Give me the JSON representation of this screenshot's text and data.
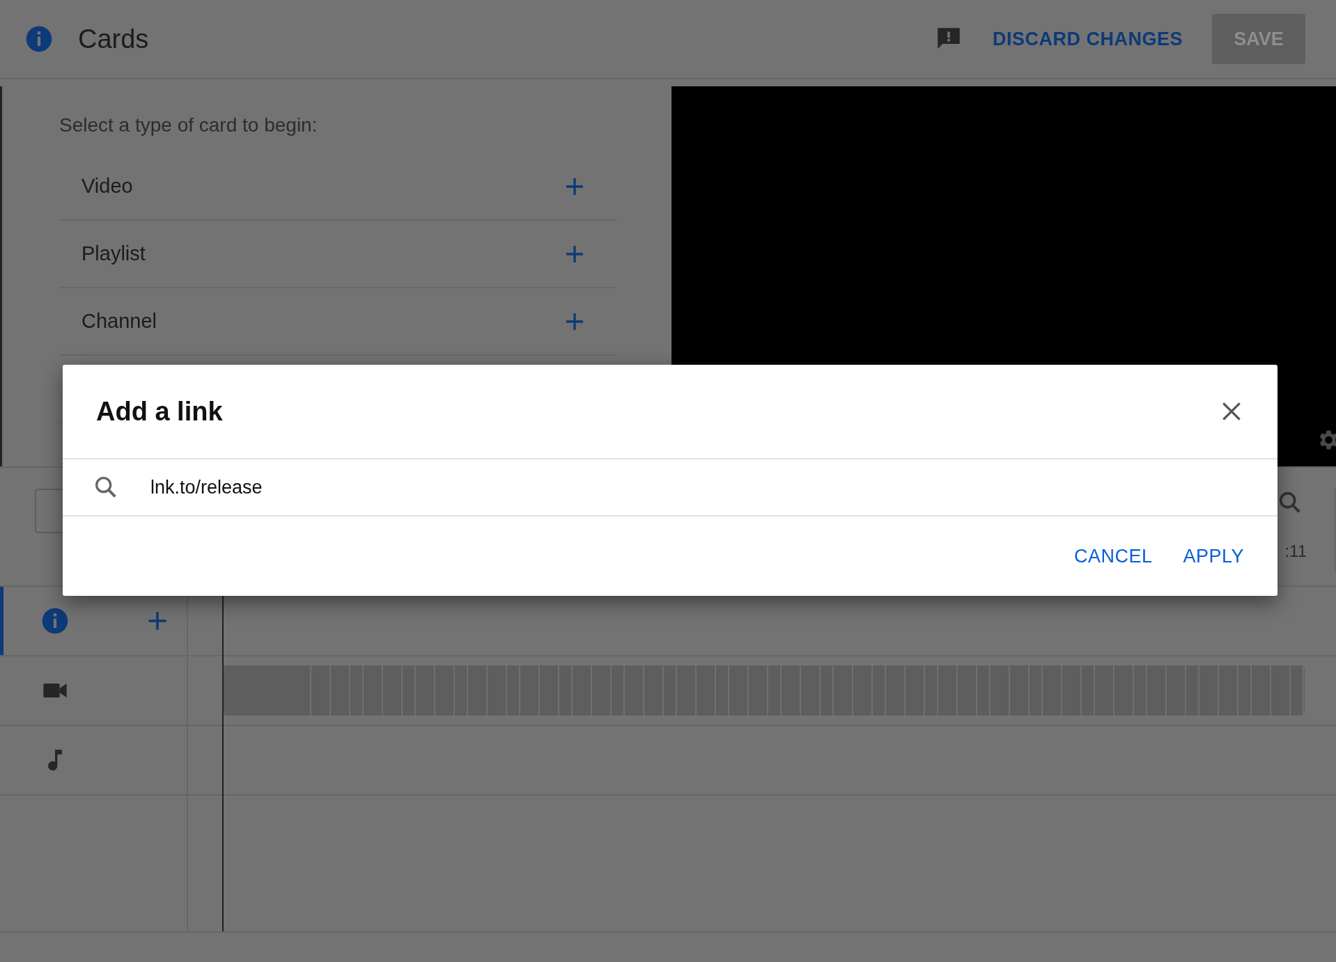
{
  "header": {
    "title": "Cards",
    "discard_label": "DISCARD CHANGES",
    "save_label": "SAVE",
    "save_disabled": true
  },
  "card_types": {
    "prompt": "Select a type of card to begin:",
    "items": [
      {
        "label": "Video"
      },
      {
        "label": "Playlist"
      },
      {
        "label": "Channel"
      }
    ]
  },
  "timeline": {
    "time_label": ":11",
    "tracks": [
      {
        "kind": "info",
        "selected": true
      },
      {
        "kind": "video",
        "selected": false
      },
      {
        "kind": "audio",
        "selected": false
      }
    ]
  },
  "dialog": {
    "title": "Add a link",
    "search": {
      "value": "lnk.to/release"
    },
    "buttons": [
      "CANCEL",
      "APPLY"
    ]
  }
}
